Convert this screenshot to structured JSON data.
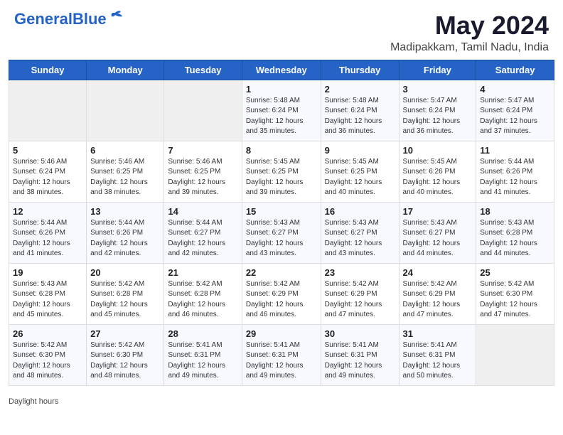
{
  "header": {
    "logo_line1": "General",
    "logo_line2": "Blue",
    "title": "May 2024",
    "subtitle": "Madipakkam, Tamil Nadu, India"
  },
  "columns": [
    "Sunday",
    "Monday",
    "Tuesday",
    "Wednesday",
    "Thursday",
    "Friday",
    "Saturday"
  ],
  "weeks": [
    [
      {
        "day": "",
        "info": ""
      },
      {
        "day": "",
        "info": ""
      },
      {
        "day": "",
        "info": ""
      },
      {
        "day": "1",
        "info": "Sunrise: 5:48 AM\nSunset: 6:24 PM\nDaylight: 12 hours and 35 minutes."
      },
      {
        "day": "2",
        "info": "Sunrise: 5:48 AM\nSunset: 6:24 PM\nDaylight: 12 hours and 36 minutes."
      },
      {
        "day": "3",
        "info": "Sunrise: 5:47 AM\nSunset: 6:24 PM\nDaylight: 12 hours and 36 minutes."
      },
      {
        "day": "4",
        "info": "Sunrise: 5:47 AM\nSunset: 6:24 PM\nDaylight: 12 hours and 37 minutes."
      }
    ],
    [
      {
        "day": "5",
        "info": "Sunrise: 5:46 AM\nSunset: 6:24 PM\nDaylight: 12 hours and 38 minutes."
      },
      {
        "day": "6",
        "info": "Sunrise: 5:46 AM\nSunset: 6:25 PM\nDaylight: 12 hours and 38 minutes."
      },
      {
        "day": "7",
        "info": "Sunrise: 5:46 AM\nSunset: 6:25 PM\nDaylight: 12 hours and 39 minutes."
      },
      {
        "day": "8",
        "info": "Sunrise: 5:45 AM\nSunset: 6:25 PM\nDaylight: 12 hours and 39 minutes."
      },
      {
        "day": "9",
        "info": "Sunrise: 5:45 AM\nSunset: 6:25 PM\nDaylight: 12 hours and 40 minutes."
      },
      {
        "day": "10",
        "info": "Sunrise: 5:45 AM\nSunset: 6:26 PM\nDaylight: 12 hours and 40 minutes."
      },
      {
        "day": "11",
        "info": "Sunrise: 5:44 AM\nSunset: 6:26 PM\nDaylight: 12 hours and 41 minutes."
      }
    ],
    [
      {
        "day": "12",
        "info": "Sunrise: 5:44 AM\nSunset: 6:26 PM\nDaylight: 12 hours and 41 minutes."
      },
      {
        "day": "13",
        "info": "Sunrise: 5:44 AM\nSunset: 6:26 PM\nDaylight: 12 hours and 42 minutes."
      },
      {
        "day": "14",
        "info": "Sunrise: 5:44 AM\nSunset: 6:27 PM\nDaylight: 12 hours and 42 minutes."
      },
      {
        "day": "15",
        "info": "Sunrise: 5:43 AM\nSunset: 6:27 PM\nDaylight: 12 hours and 43 minutes."
      },
      {
        "day": "16",
        "info": "Sunrise: 5:43 AM\nSunset: 6:27 PM\nDaylight: 12 hours and 43 minutes."
      },
      {
        "day": "17",
        "info": "Sunrise: 5:43 AM\nSunset: 6:27 PM\nDaylight: 12 hours and 44 minutes."
      },
      {
        "day": "18",
        "info": "Sunrise: 5:43 AM\nSunset: 6:28 PM\nDaylight: 12 hours and 44 minutes."
      }
    ],
    [
      {
        "day": "19",
        "info": "Sunrise: 5:43 AM\nSunset: 6:28 PM\nDaylight: 12 hours and 45 minutes."
      },
      {
        "day": "20",
        "info": "Sunrise: 5:42 AM\nSunset: 6:28 PM\nDaylight: 12 hours and 45 minutes."
      },
      {
        "day": "21",
        "info": "Sunrise: 5:42 AM\nSunset: 6:28 PM\nDaylight: 12 hours and 46 minutes."
      },
      {
        "day": "22",
        "info": "Sunrise: 5:42 AM\nSunset: 6:29 PM\nDaylight: 12 hours and 46 minutes."
      },
      {
        "day": "23",
        "info": "Sunrise: 5:42 AM\nSunset: 6:29 PM\nDaylight: 12 hours and 47 minutes."
      },
      {
        "day": "24",
        "info": "Sunrise: 5:42 AM\nSunset: 6:29 PM\nDaylight: 12 hours and 47 minutes."
      },
      {
        "day": "25",
        "info": "Sunrise: 5:42 AM\nSunset: 6:30 PM\nDaylight: 12 hours and 47 minutes."
      }
    ],
    [
      {
        "day": "26",
        "info": "Sunrise: 5:42 AM\nSunset: 6:30 PM\nDaylight: 12 hours and 48 minutes."
      },
      {
        "day": "27",
        "info": "Sunrise: 5:42 AM\nSunset: 6:30 PM\nDaylight: 12 hours and 48 minutes."
      },
      {
        "day": "28",
        "info": "Sunrise: 5:41 AM\nSunset: 6:31 PM\nDaylight: 12 hours and 49 minutes."
      },
      {
        "day": "29",
        "info": "Sunrise: 5:41 AM\nSunset: 6:31 PM\nDaylight: 12 hours and 49 minutes."
      },
      {
        "day": "30",
        "info": "Sunrise: 5:41 AM\nSunset: 6:31 PM\nDaylight: 12 hours and 49 minutes."
      },
      {
        "day": "31",
        "info": "Sunrise: 5:41 AM\nSunset: 6:31 PM\nDaylight: 12 hours and 50 minutes."
      },
      {
        "day": "",
        "info": ""
      }
    ]
  ],
  "footer": "Daylight hours"
}
